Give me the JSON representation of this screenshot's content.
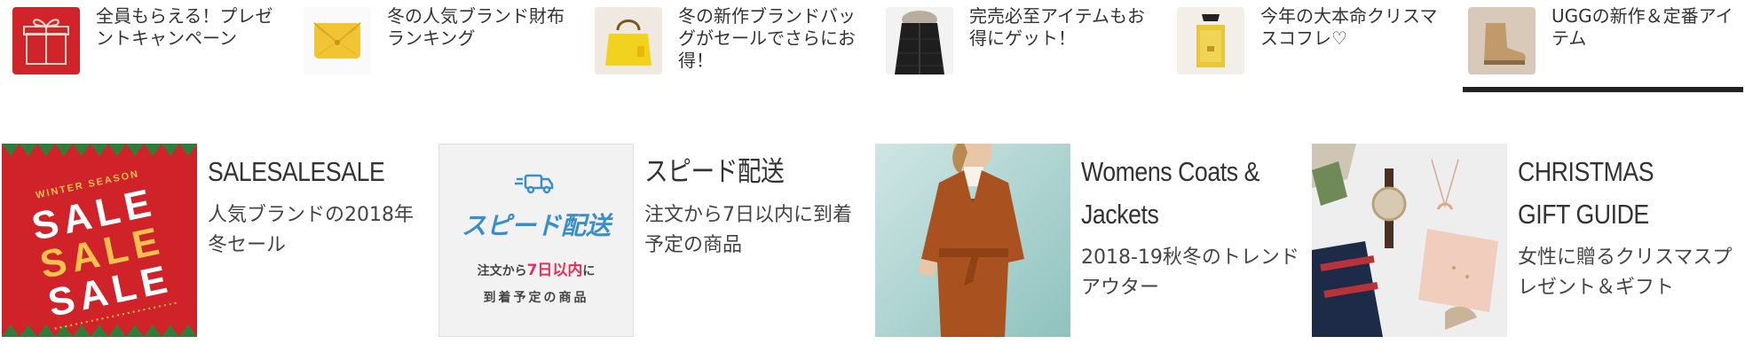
{
  "top_items": [
    {
      "label": "全員もらえる！プレゼントキャンペーン",
      "icon": "gift-box-icon"
    },
    {
      "label": "冬の人気ブランド財布ランキング",
      "icon": "wallet-icon"
    },
    {
      "label": "冬の新作ブランドバッグがセールでさらにお得！",
      "icon": "handbag-icon"
    },
    {
      "label": "完売必至アイテムもお得にゲット！",
      "icon": "down-jacket-icon"
    },
    {
      "label": "今年の大本命クリスマスコフレ♡",
      "icon": "cosmetics-icon"
    },
    {
      "label": "UGGの新作＆定番アイテム",
      "icon": "boot-icon"
    }
  ],
  "active_top_index": 5,
  "cards": [
    {
      "title": "SALESALESALE",
      "subtitle": "人気ブランドの2018年冬セール",
      "image": {
        "season": "WINTER SEASON",
        "word": "SALE"
      }
    },
    {
      "title": "スピード配送",
      "subtitle": "注文から7日以内に到着予定の商品",
      "image": {
        "heading": "スピード配送",
        "line1_pre": "注文から",
        "line1_hl": "7日以内",
        "line1_post": "に",
        "line2": "到着予定の商品",
        "icon": "delivery-truck-icon"
      }
    },
    {
      "title": "Womens Coats & Jackets",
      "subtitle": "2018-19秋冬のトレンドアウター",
      "image": {}
    },
    {
      "title": "CHRISTMAS GIFT GUIDE",
      "subtitle": "女性に贈るクリスマスプレゼント＆ギフト",
      "image": {}
    }
  ],
  "colors": {
    "accent_red": "#d1232a",
    "sale_gold": "#f2c14e",
    "speed_blue": "#3a8fc9",
    "highlight_pink": "#e0325f",
    "active_bar": "#222222"
  }
}
